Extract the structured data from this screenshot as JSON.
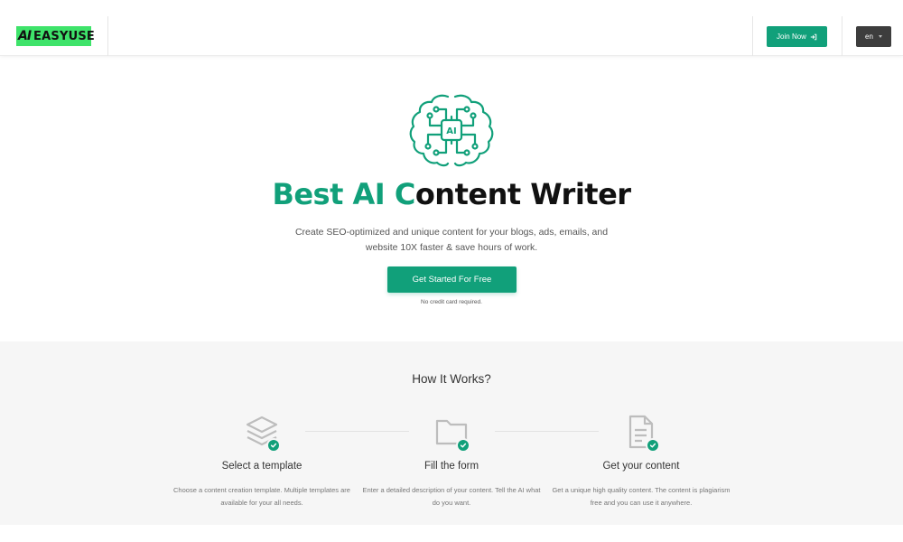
{
  "header": {
    "logo_mark": "AI",
    "logo_text": "EASYUSE",
    "join_label": "Join Now",
    "lang_label": "en"
  },
  "hero": {
    "title_accent_1": "Best AI C",
    "title_rest": "ontent Writer",
    "subtitle": "Create SEO-optimized and unique content for your blogs, ads, emails, and website 10X faster & save hours of work.",
    "cta_label": "Get Started For Free",
    "note": "No credit card required.",
    "icon_label": "AI"
  },
  "how": {
    "title": "How It Works?",
    "steps": [
      {
        "title": "Select a template",
        "desc": "Choose a content creation template. Multiple templates are available for your all needs.",
        "icon": "layers-icon"
      },
      {
        "title": "Fill the form",
        "desc": "Enter a detailed description of your content. Tell the AI what do you want.",
        "icon": "folder-icon"
      },
      {
        "title": "Get your content",
        "desc": "Get a unique high quality content. The content is plagiarism free and you can use it anywhere.",
        "icon": "document-icon"
      }
    ]
  },
  "colors": {
    "accent": "#11a07a",
    "logo_bg": "#3ee36a",
    "lang_bg": "#3d3d3d"
  }
}
